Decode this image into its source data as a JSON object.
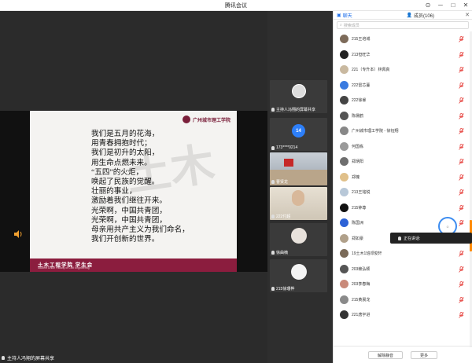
{
  "window": {
    "title": "腾讯会议"
  },
  "stage": {
    "slide": {
      "school_name": "广州城市理工学院",
      "watermark": "土木",
      "poem": [
        "我们是五月的花海，",
        "用青春拥抱时代；",
        "我们是初升的太阳，",
        "用生命点燃未来。",
        "“五四”的火炬，",
        "唤起了民族的觉醒。",
        "壮丽的事业，",
        "激励着我们继往开来。",
        "光荣啊，中国共青团，",
        "光荣啊，中国共青团，",
        "母亲用共产主义为我们命名，",
        "我们开创新的世界。"
      ],
      "footer_text": "土木工程学院 学生会",
      "footer_sub": "Student Union Faculty of Civil Engineering"
    },
    "label": "主持人冯翔的屏幕共享"
  },
  "strip": {
    "tiles": [
      {
        "label": "主持人冯翔的屏幕共享"
      },
      {
        "label": "173****0214",
        "avatar": "14",
        "accent": "#2d7ff9"
      },
      {
        "label": "曹贤龙"
      },
      {
        "label": "222付超"
      },
      {
        "label": "徐曲楠"
      },
      {
        "label": "215徐珊桦"
      }
    ]
  },
  "panel": {
    "tabs": {
      "chat": "聊天",
      "members": "成员(106)"
    },
    "search_placeholder": "搜索成员",
    "members": [
      {
        "name": "215王培城",
        "color": "#7d6b5a"
      },
      {
        "name": "213但旺华",
        "color": "#222222"
      },
      {
        "name": "221（专升本）林佩真",
        "color": "#c9b9a0"
      },
      {
        "name": "222雷芯蔓",
        "color": "#3a7be0"
      },
      {
        "name": "222徐睿",
        "color": "#444444"
      },
      {
        "name": "陈儒鹤",
        "color": "#555555"
      },
      {
        "name": "广州城市理工学院 - 徐钰翔",
        "color": "#888888"
      },
      {
        "name": "何国栋",
        "color": "#9a9a9a"
      },
      {
        "name": "郑炳阳",
        "color": "#6e6e6e"
      },
      {
        "name": "郑槐",
        "color": "#e0c08a"
      },
      {
        "name": "213王铭锐",
        "color": "#b8c8d8"
      },
      {
        "name": "215钟尊",
        "color": "#111111"
      },
      {
        "name": "陈国洲",
        "color": "#2d62d6"
      },
      {
        "name": "郑如豪",
        "color": "#b0a08a"
      },
      {
        "name": "19土木1班邓俊轩",
        "color": "#7a6a58"
      },
      {
        "name": "203赖弘颖",
        "color": "#555555"
      },
      {
        "name": "203李春梅",
        "color": "#c98a7a"
      },
      {
        "name": "215黄晨龙",
        "color": "#8a8a8a"
      },
      {
        "name": "221唐宇进",
        "color": "#333333"
      }
    ],
    "speaking_label": "正在讲话:",
    "buttons": {
      "unmute_all": "解除静音",
      "close": "更多"
    }
  }
}
